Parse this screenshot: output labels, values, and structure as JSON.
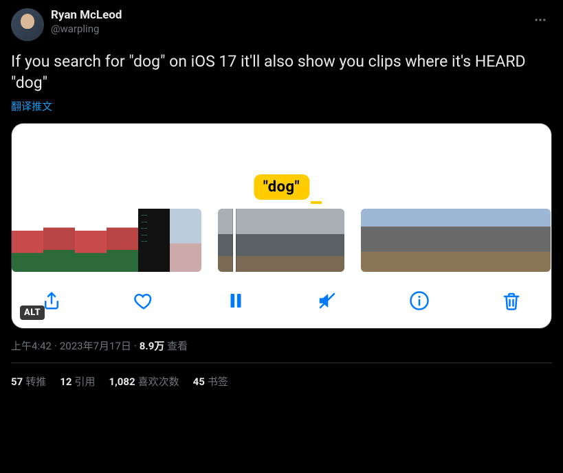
{
  "author": {
    "display_name": "Ryan McLeod",
    "handle": "@warpling"
  },
  "tweet_text": "If you search for \"dog\" on iOS 17 it'll also show you clips where it's HEARD \"dog\"",
  "translate_label": "翻译推文",
  "media": {
    "search_chip": "\"dog\"",
    "alt_badge": "ALT",
    "toolbar_icons": {
      "share": "share-icon",
      "heart": "heart-icon",
      "pause": "pause-icon",
      "mute": "mute-icon",
      "info": "info-icon",
      "trash": "trash-icon"
    }
  },
  "meta": {
    "time": "上午4:42",
    "date": "2023年7月17日",
    "views_value": "8.9万",
    "views_label": "查看"
  },
  "stats": {
    "retweets_count": "57",
    "retweets_label": "转推",
    "quotes_count": "12",
    "quotes_label": "引用",
    "likes_count": "1,082",
    "likes_label": "喜欢次数",
    "bookmarks_count": "45",
    "bookmarks_label": "书签"
  }
}
